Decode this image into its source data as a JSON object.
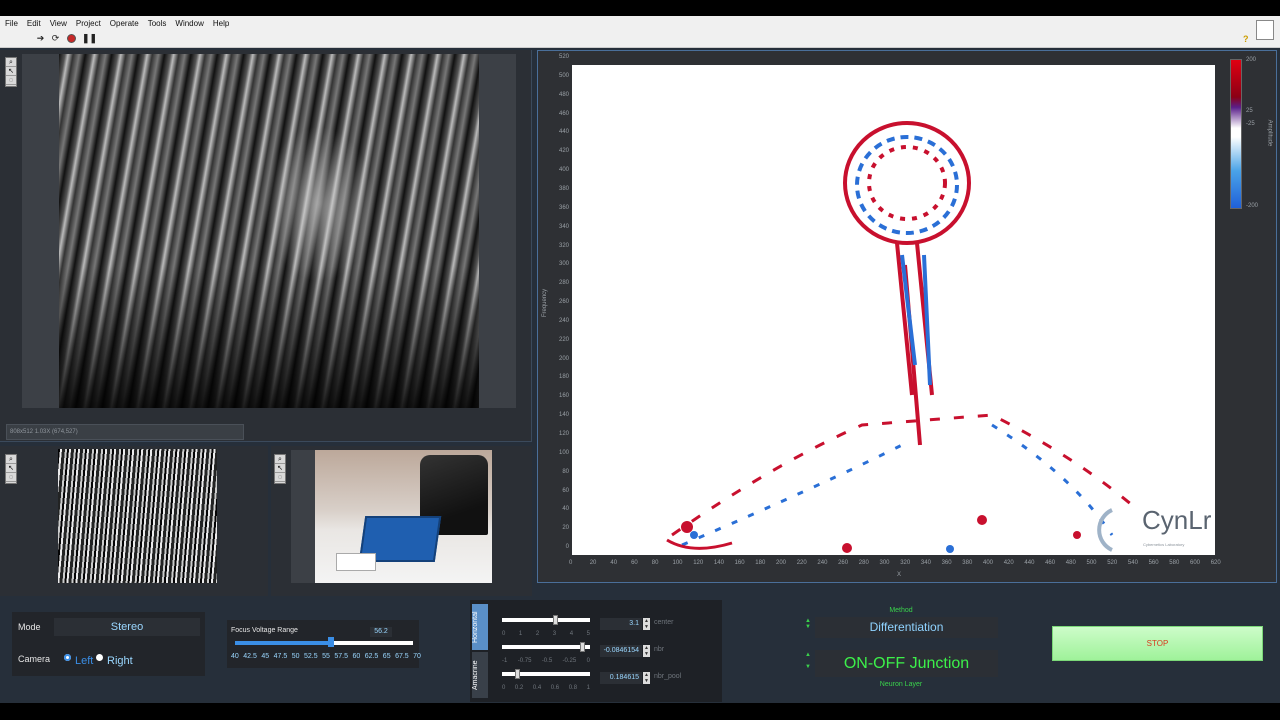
{
  "menu": [
    "File",
    "Edit",
    "View",
    "Project",
    "Operate",
    "Tools",
    "Window",
    "Help"
  ],
  "toolbar": {
    "icons": [
      "run-arrow-icon",
      "run-continuous-icon",
      "abort-icon",
      "pause-icon"
    ],
    "help": "?"
  },
  "main_image": {
    "status_text": "808x512 1.03X    (674,527)"
  },
  "plot": {
    "ylabel": "Frequency",
    "xlabel": "X",
    "colorbar_label": "Amplitude",
    "y_ticks": [
      "520",
      "500",
      "480",
      "460",
      "440",
      "420",
      "400",
      "380",
      "360",
      "340",
      "320",
      "300",
      "280",
      "260",
      "240",
      "220",
      "200",
      "180",
      "160",
      "140",
      "120",
      "100",
      "80",
      "60",
      "40",
      "20",
      "0"
    ],
    "x_ticks": [
      "0",
      "20",
      "40",
      "60",
      "80",
      "100",
      "120",
      "140",
      "160",
      "180",
      "200",
      "220",
      "240",
      "260",
      "280",
      "300",
      "320",
      "340",
      "360",
      "380",
      "400",
      "420",
      "440",
      "460",
      "480",
      "500",
      "520",
      "540",
      "560",
      "580",
      "600",
      "620"
    ],
    "colorbar_ticks": [
      "200",
      "25",
      "-25",
      "-200"
    ],
    "watermark": "CynLr",
    "watermark_sub": "Cybernetics Laboratory"
  },
  "controls": {
    "mode_label": "Mode",
    "mode_value": "Stereo",
    "camera_label": "Camera",
    "camera_left": "Left",
    "camera_right": "Right",
    "focus_label": "Focus Voltage Range",
    "focus_value": "56.2",
    "focus_scale": [
      "40",
      "42.5",
      "45",
      "47.5",
      "50",
      "52.5",
      "55",
      "57.5",
      "60",
      "62.5",
      "65",
      "67.5",
      "70"
    ],
    "tab_horizontal": "Horizontal",
    "tab_amacrine": "Amacrine",
    "center_value": "3.1",
    "center_label": "center",
    "nbr_value": "-0.0846154",
    "nbr_label": "nbr",
    "nbr_pool_value": "0.184615",
    "nbr_pool_label": "nbr_pool",
    "scale1": [
      "0",
      "1",
      "2",
      "3",
      "4",
      "5"
    ],
    "scale2": [
      "-1",
      "-0.75",
      "-0.5",
      "-0.25",
      "0"
    ],
    "scale3": [
      "0",
      "0.2",
      "0.4",
      "0.6",
      "0.8",
      "1"
    ],
    "method_label": "Method",
    "method_value": "Differentiation",
    "neuron_value": "ON-OFF Junction",
    "neuron_label": "Neuron Layer",
    "stop_label": "STOP"
  },
  "colors": {
    "accent": "#3a8ee6",
    "green": "#3cf04a",
    "stop_bg": "#a8f5a4"
  }
}
